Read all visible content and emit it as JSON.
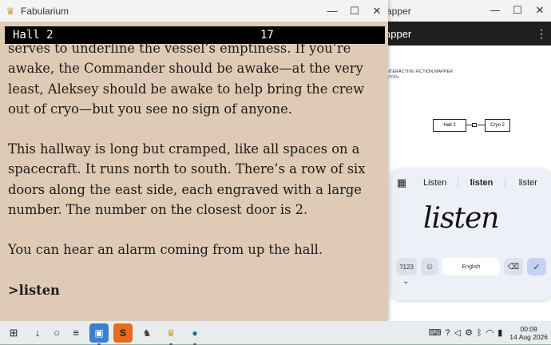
{
  "fabularium": {
    "title": "Fabularium",
    "status_location": "Hall 2",
    "status_moves": "17",
    "paragraphs": [
      "serves to underline the vessel’s emptiness.  If you’re awake, the Commander should be awake—at the very least, Aleksey should be awake to help bring the crew out of cryo—but you see no sign of anyone.",
      "This hallway is long but cramped, like all spaces on a spacecraft.  It runs north to south.  There’s a row of six doors along the east side, each engraved with a large number.  The number on the closest door is 2.",
      "You can hear an alarm coming from up the hall."
    ],
    "prompt": ">listen"
  },
  "mapper": {
    "title": "apper",
    "appbar_title": "apper",
    "map_title": "NTERACTIVE FICTION MAPPER",
    "map_subtitle": "uTORx",
    "rooms": [
      "Hall 2",
      "Cryo 2"
    ]
  },
  "keyboard": {
    "suggestions": [
      "Listen",
      "listen",
      "lister"
    ],
    "handwriting": "listen",
    "key_numbers": "?123",
    "key_language": "English"
  },
  "window_controls": {
    "minimize": "—",
    "maximize": "☐",
    "close": "✕"
  },
  "taskbar": {
    "time": "00:09",
    "date": "14 Aug 2026"
  },
  "colors": {
    "story_bg": "#dfcbb5",
    "status_bg": "#000000",
    "keyboard_bg": "#eef0f7"
  }
}
